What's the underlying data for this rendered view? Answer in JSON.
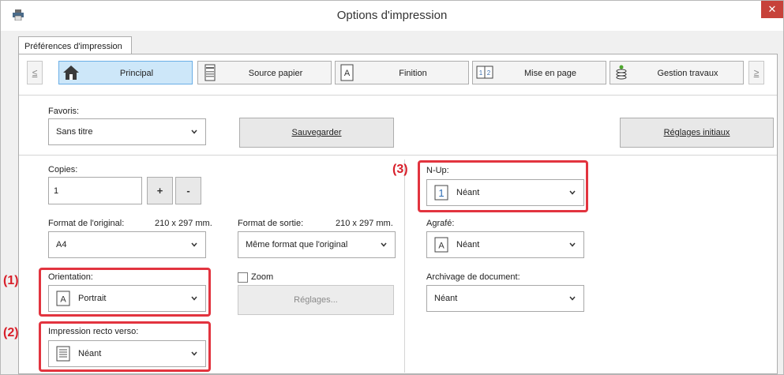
{
  "window": {
    "title": "Options d'impression"
  },
  "tabs": [
    {
      "label": "Préférences d'impression"
    }
  ],
  "nav": {
    "prev_label": "≤",
    "next_label": "≥",
    "items": [
      {
        "label": "Principal",
        "icon": "home-icon",
        "active": true
      },
      {
        "label": "Source papier",
        "icon": "paper-tray-icon",
        "active": false
      },
      {
        "label": "Finition",
        "icon": "finishing-icon",
        "active": false
      },
      {
        "label": "Mise en page",
        "icon": "layout-icon",
        "active": false
      },
      {
        "label": "Gestion travaux",
        "icon": "job-management-icon",
        "active": false
      }
    ]
  },
  "favorites": {
    "label": "Favoris:",
    "value": "Sans titre",
    "save_label": "Sauvegarder",
    "reset_label": "Réglages initiaux"
  },
  "copies": {
    "label": "Copies:",
    "value": "1",
    "plus_label": "+",
    "minus_label": "-"
  },
  "original_size": {
    "label": "Format de l'original:",
    "dimensions": "210 x 297 mm.",
    "value": "A4"
  },
  "output_size": {
    "label": "Format de sortie:",
    "dimensions": "210 x 297 mm.",
    "value": "Même format que l'original"
  },
  "orientation": {
    "label": "Orientation:",
    "value": "Portrait",
    "icon": "portrait-page-icon"
  },
  "zoom": {
    "label": "Zoom",
    "checked": false,
    "settings_label": "Réglages..."
  },
  "duplex": {
    "label": "Impression recto verso:",
    "value": "Néant",
    "icon": "one-sided-page-icon"
  },
  "n_up": {
    "label": "N-Up:",
    "value": "Néant",
    "icon": "n-up-one-icon",
    "icon_text": "1"
  },
  "staple": {
    "label": "Agrafé:",
    "value": "Néant",
    "icon": "staple-page-icon"
  },
  "document_filing": {
    "label": "Archivage de document:",
    "value": "Néant"
  },
  "callouts": {
    "c1": "(1)",
    "c2": "(2)",
    "c3": "(3)"
  },
  "colors": {
    "highlight": "#e2343f",
    "active_tab": "#cde7f9",
    "close_button": "#c7423a"
  }
}
